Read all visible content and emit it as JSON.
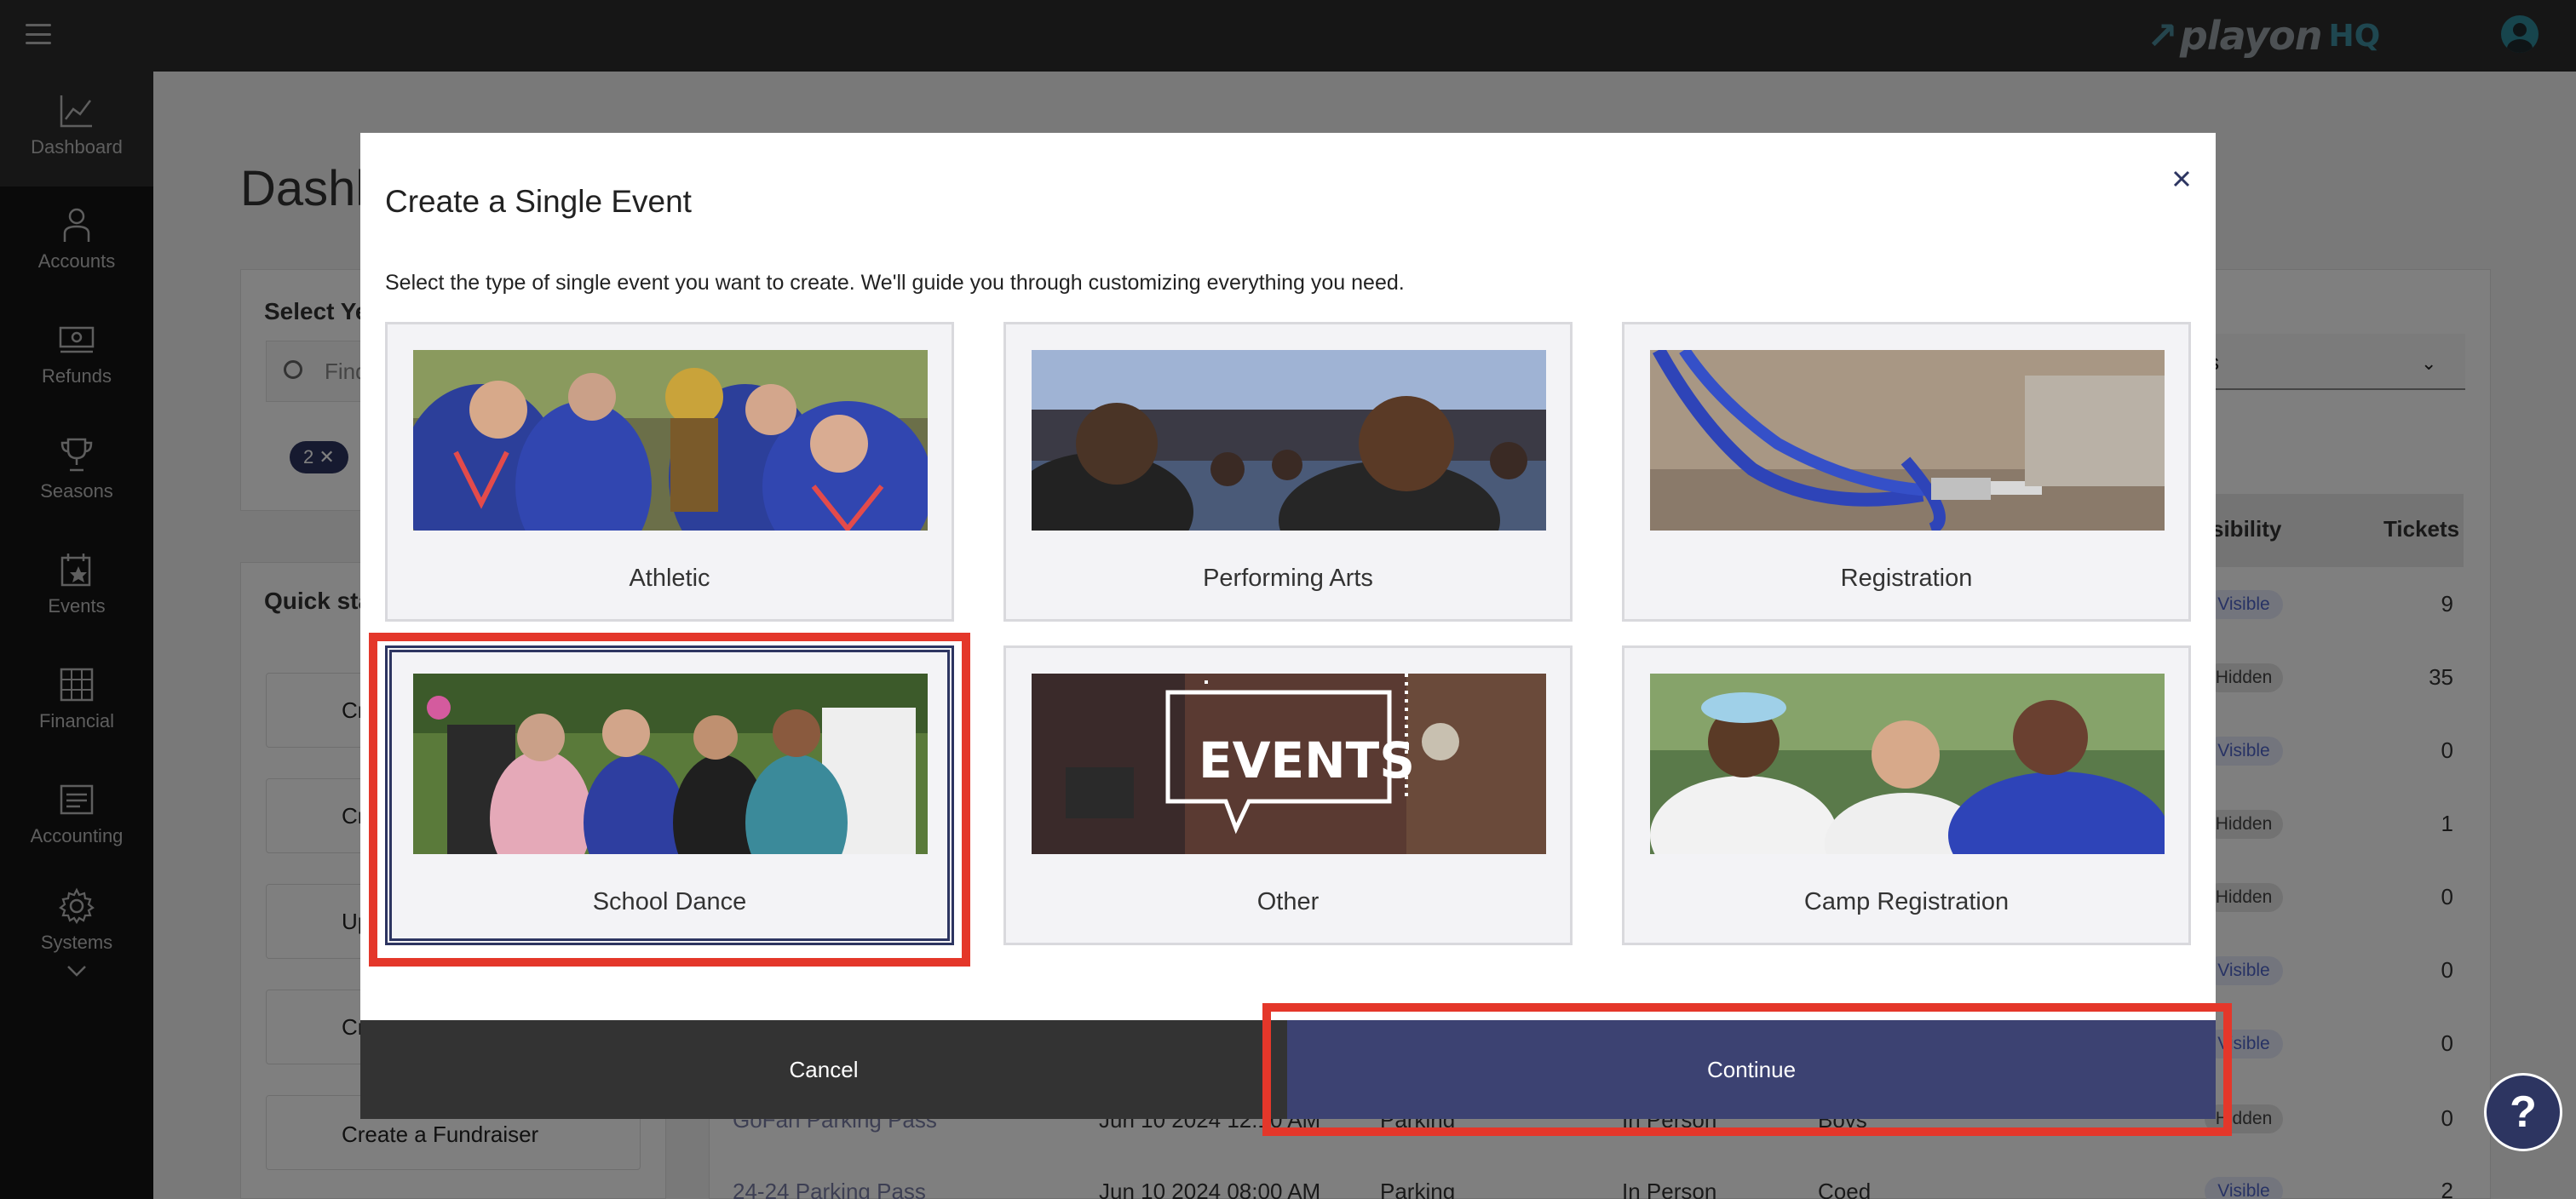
{
  "topbar": {
    "brand": "playon",
    "brand_suffix": "HQ"
  },
  "sidebar": {
    "items": [
      {
        "label": "Dashboard",
        "icon": "chart-icon"
      },
      {
        "label": "Accounts",
        "icon": "person-icon"
      },
      {
        "label": "Refunds",
        "icon": "cash-icon"
      },
      {
        "label": "Seasons",
        "icon": "trophy-icon"
      },
      {
        "label": "Events",
        "icon": "calendar-star-icon"
      },
      {
        "label": "Financial",
        "icon": "grid-icon"
      },
      {
        "label": "Accounting",
        "icon": "ledger-icon"
      },
      {
        "label": "Systems",
        "icon": "gear-icon"
      }
    ]
  },
  "background": {
    "page_title": "Dashb",
    "select_label": "Select Ye",
    "search_placeholder": "Find",
    "chip_count": "2",
    "quick_start": "Quick sta",
    "quick_items": [
      "Cr",
      "Cr",
      "Up",
      "Cr",
      "Create a Fundraiser"
    ],
    "dropdown_text": "ents",
    "col_visibility": "sibility",
    "col_tickets": "Tickets",
    "rows": [
      {
        "status": "Visible",
        "tickets": "9"
      },
      {
        "status": "Hidden",
        "tickets": "35"
      },
      {
        "status": "Visible",
        "tickets": "0"
      },
      {
        "status": "Hidden",
        "tickets": "1"
      },
      {
        "status": "Hidden",
        "tickets": "0"
      },
      {
        "status": "Visible",
        "tickets": "0"
      },
      {
        "status": "Visible",
        "tickets": "0"
      },
      {
        "status": "Hidden",
        "tickets": "0"
      },
      {
        "status": "Visible",
        "tickets": "2"
      }
    ],
    "row_a": {
      "name": "GoFan Parking Pass",
      "date": "Jun 10 2024 12:10 AM",
      "type": "Parking",
      "mode": "In Person",
      "gender": "Boys"
    },
    "row_b": {
      "name": "24-24 Parking Pass",
      "date": "Jun 10 2024 08:00 AM",
      "type": "Parking",
      "mode": "In Person",
      "gender": "Coed"
    }
  },
  "modal": {
    "title": "Create a Single Event",
    "subtitle": "Select the type of single event you want to create. We'll guide you through customizing everything you need.",
    "cards": [
      {
        "label": "Athletic"
      },
      {
        "label": "Performing Arts"
      },
      {
        "label": "Registration"
      },
      {
        "label": "School Dance",
        "selected": true
      },
      {
        "label": "Other",
        "overlay_text": "EVENTS"
      },
      {
        "label": "Camp Registration"
      }
    ],
    "cancel_label": "Cancel",
    "continue_label": "Continue"
  },
  "help": {
    "label": "?"
  }
}
